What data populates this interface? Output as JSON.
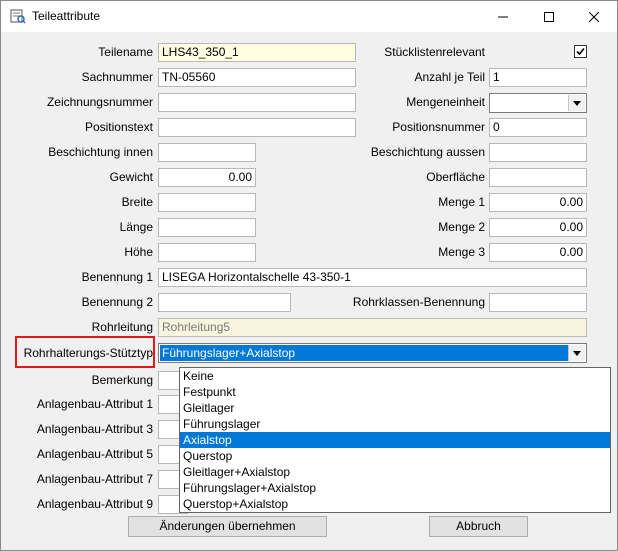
{
  "window": {
    "title": "Teileattribute"
  },
  "form": {
    "teilename": {
      "label": "Teilename",
      "value": "LHS43_350_1"
    },
    "stuecklistenrelevant": {
      "label": "Stücklistenrelevant",
      "checked": true
    },
    "sachnummer": {
      "label": "Sachnummer",
      "value": "TN-05560"
    },
    "anzahl_je_teil": {
      "label": "Anzahl je Teil",
      "value": "1"
    },
    "zeichnungsnummer": {
      "label": "Zeichnungsnummer",
      "value": ""
    },
    "mengeneinheit": {
      "label": "Mengeneinheit",
      "value": ""
    },
    "positionstext": {
      "label": "Positionstext",
      "value": ""
    },
    "positionsnummer": {
      "label": "Positionsnummer",
      "value": "0"
    },
    "beschichtung_innen": {
      "label": "Beschichtung innen",
      "value": ""
    },
    "beschichtung_aussen": {
      "label": "Beschichtung aussen",
      "value": ""
    },
    "gewicht": {
      "label": "Gewicht",
      "value": "0.00"
    },
    "oberflaeche": {
      "label": "Oberfläche",
      "value": ""
    },
    "breite": {
      "label": "Breite",
      "value": ""
    },
    "menge1": {
      "label": "Menge 1",
      "value": "0.00"
    },
    "laenge": {
      "label": "Länge",
      "value": ""
    },
    "menge2": {
      "label": "Menge 2",
      "value": "0.00"
    },
    "hoehe": {
      "label": "Höhe",
      "value": ""
    },
    "menge3": {
      "label": "Menge 3",
      "value": "0.00"
    },
    "benennung1": {
      "label": "Benennung 1",
      "value": "LISEGA Horizontalschelle 43-350-1"
    },
    "benennung2": {
      "label": "Benennung 2",
      "value": ""
    },
    "rohrklassen_benennung": {
      "label": "Rohrklassen-Benennung",
      "value": ""
    },
    "rohrleitung": {
      "label": "Rohrleitung",
      "value": "Rohrleitung5"
    },
    "stuetztyp": {
      "label": "Rohrhalterungs-Stütztyp",
      "value": "Führungslager+Axialstop"
    },
    "bemerkung": {
      "label": "Bemerkung"
    },
    "attr1": {
      "label": "Anlagenbau-Attribut 1"
    },
    "attr3": {
      "label": "Anlagenbau-Attribut 3"
    },
    "attr5": {
      "label": "Anlagenbau-Attribut 5"
    },
    "attr7": {
      "label": "Anlagenbau-Attribut 7"
    },
    "attr9": {
      "label": "Anlagenbau-Attribut 9"
    }
  },
  "dropdown": {
    "options": [
      "Keine",
      "Festpunkt",
      "Gleitlager",
      "Führungslager",
      "Axialstop",
      "Querstop",
      "Gleitlager+Axialstop",
      "Führungslager+Axialstop",
      "Querstop+Axialstop"
    ],
    "highlighted_index": 4
  },
  "buttons": {
    "apply": "Änderungen übernehmen",
    "cancel": "Abbruch"
  },
  "colors": {
    "highlight": "#0078d7",
    "name_field": "#ffffe1",
    "callout": "#e21a1a"
  }
}
